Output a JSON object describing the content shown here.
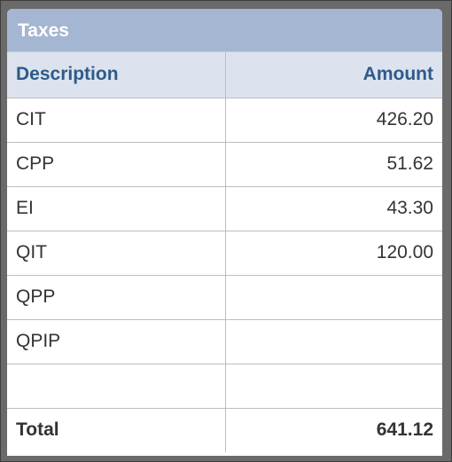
{
  "panel": {
    "title": "Taxes"
  },
  "table": {
    "headers": {
      "description": "Description",
      "amount": "Amount"
    },
    "rows": [
      {
        "description": "CIT",
        "amount": "426.20"
      },
      {
        "description": "CPP",
        "amount": "51.62"
      },
      {
        "description": "EI",
        "amount": "43.30"
      },
      {
        "description": "QIT",
        "amount": "120.00"
      },
      {
        "description": "QPP",
        "amount": ""
      },
      {
        "description": "QPIP",
        "amount": ""
      },
      {
        "description": "",
        "amount": ""
      }
    ],
    "total": {
      "label": "Total",
      "amount": "641.12"
    }
  },
  "colors": {
    "title_bar": "#a5b6d2",
    "header_bg": "#dde3ee",
    "header_text": "#2e5a8a"
  }
}
